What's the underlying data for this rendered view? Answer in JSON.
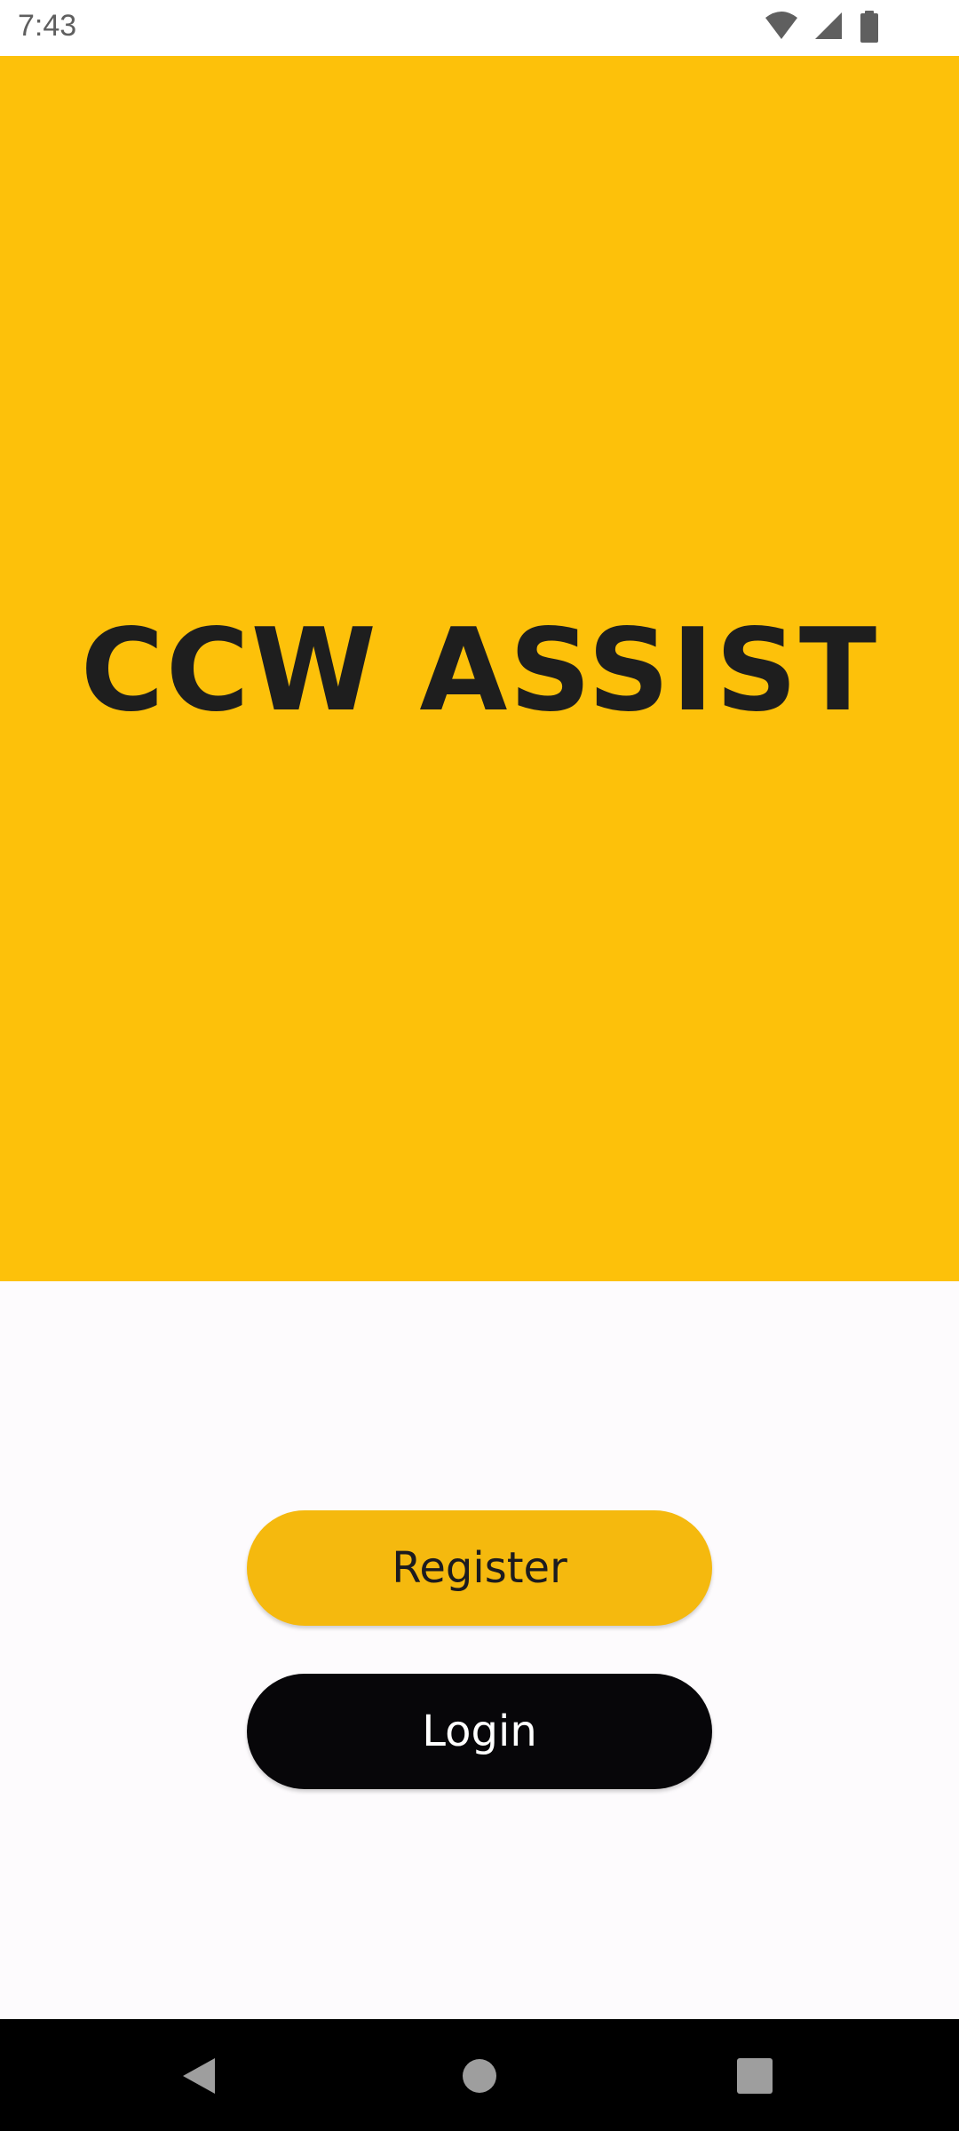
{
  "status_bar": {
    "time": "7:43",
    "icons": [
      "wifi-icon",
      "signal-icon",
      "battery-icon"
    ]
  },
  "hero": {
    "title": "CCW ASSIST",
    "background_color": "#fdc10a"
  },
  "actions": {
    "register_label": "Register",
    "login_label": "Login",
    "register_color": "#f5b90e",
    "login_color": "#070609"
  },
  "nav_bar": {
    "icons": [
      "back-icon",
      "home-icon",
      "recents-icon"
    ]
  }
}
